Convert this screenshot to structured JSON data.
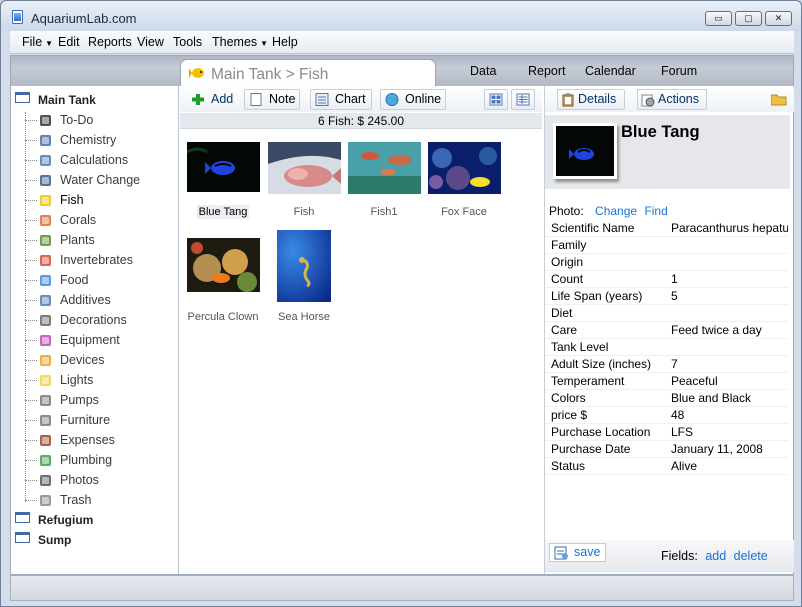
{
  "window": {
    "title": "AquariumLab.com",
    "controls": {
      "minimize": "▭",
      "maximize": "▢",
      "close": "✕"
    }
  },
  "menu": [
    "File",
    "Edit",
    "Reports",
    "View",
    "Tools",
    "Themes",
    "Help"
  ],
  "tabs": {
    "active": "Main Tank > Fish",
    "others": [
      "Data",
      "Report",
      "Calendar",
      "Forum"
    ]
  },
  "sidebar": {
    "root": "Main Tank",
    "items": [
      "To-Do",
      "Chemistry",
      "Calculations",
      "Water Change",
      "Fish",
      "Corals",
      "Plants",
      "Invertebrates",
      "Food",
      "Additives",
      "Decorations",
      "Equipment",
      "Devices",
      "Lights",
      "Pumps",
      "Furniture",
      "Expenses",
      "Plumbing",
      "Photos",
      "Trash"
    ],
    "selected": "Fish",
    "other_roots": [
      "Refugium",
      "Sump"
    ]
  },
  "toolbar": {
    "add": "Add",
    "note": "Note",
    "chart": "Chart",
    "online": "Online"
  },
  "summary": "6 Fish: $ 245.00",
  "gallery": [
    {
      "caption": "Blue Tang",
      "selected": true
    },
    {
      "caption": "Fish"
    },
    {
      "caption": "Fish1"
    },
    {
      "caption": "Fox Face"
    },
    {
      "caption": "Percula Clown"
    },
    {
      "caption": "Sea Horse"
    }
  ],
  "details": {
    "details_label": "Details",
    "actions_label": "Actions",
    "name": "Blue Tang",
    "photo_label": "Photo:",
    "change_link": "Change",
    "find_link": "Find",
    "fields": [
      {
        "k": "Scientific Name",
        "v": "Paracanthurus hepatus"
      },
      {
        "k": "Family",
        "v": ""
      },
      {
        "k": "Origin",
        "v": ""
      },
      {
        "k": "Count",
        "v": "1"
      },
      {
        "k": "Life Span (years)",
        "v": "5"
      },
      {
        "k": "Diet",
        "v": ""
      },
      {
        "k": "Care",
        "v": "Feed twice a day"
      },
      {
        "k": "Tank Level",
        "v": ""
      },
      {
        "k": "Adult Size (inches)",
        "v": "7"
      },
      {
        "k": "Temperament",
        "v": "Peaceful"
      },
      {
        "k": "Colors",
        "v": "Blue and Black"
      },
      {
        "k": "price $",
        "v": "48"
      },
      {
        "k": "Purchase Location",
        "v": "LFS"
      },
      {
        "k": "Purchase Date",
        "v": "January 11, 2008"
      },
      {
        "k": "Status",
        "v": "Alive"
      }
    ],
    "save": "save",
    "fields_label": "Fields:",
    "add_link": "add",
    "delete_link": "delete"
  }
}
